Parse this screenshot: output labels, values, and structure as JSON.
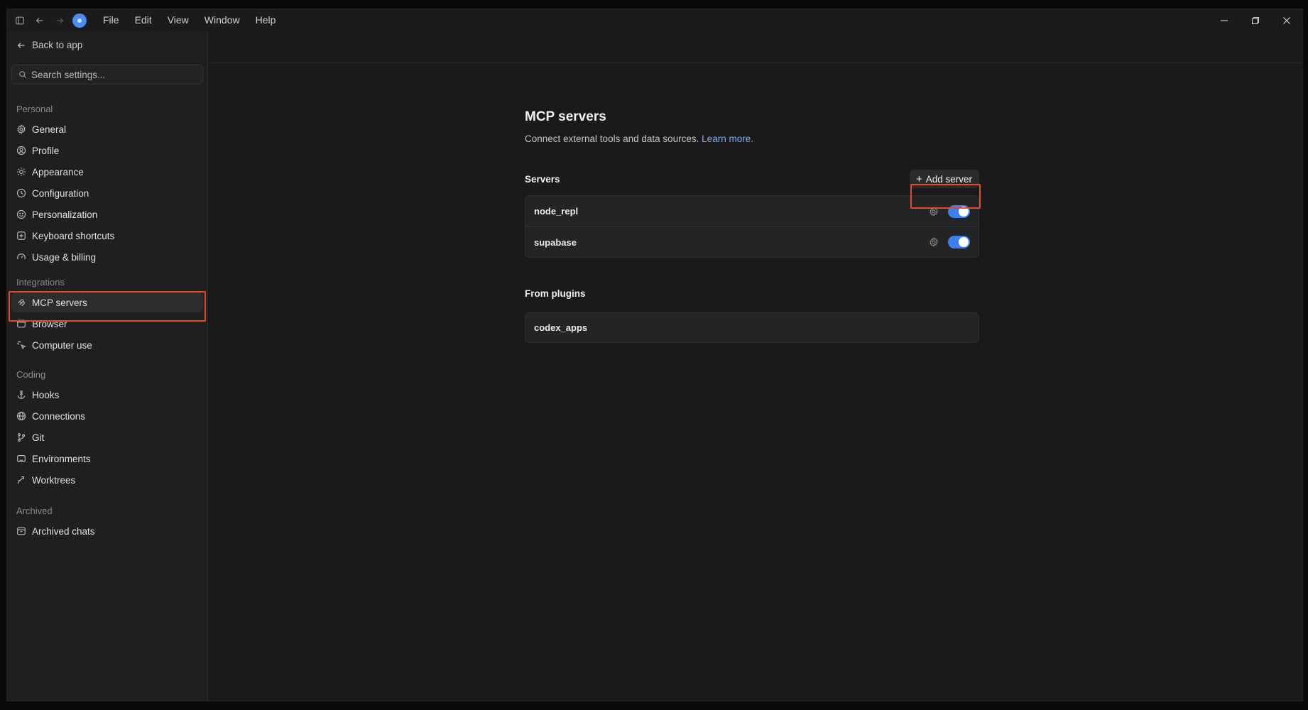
{
  "titlebar": {
    "menu": [
      "File",
      "Edit",
      "View",
      "Window",
      "Help"
    ]
  },
  "sidebar": {
    "back_label": "Back to app",
    "search_placeholder": "Search settings...",
    "sections": {
      "personal": "Personal",
      "integrations": "Integrations",
      "coding": "Coding",
      "archived": "Archived"
    },
    "personal_items": [
      "General",
      "Profile",
      "Appearance",
      "Configuration",
      "Personalization",
      "Keyboard shortcuts",
      "Usage & billing"
    ],
    "integration_items": [
      "MCP servers",
      "Browser",
      "Computer use"
    ],
    "coding_items": [
      "Hooks",
      "Connections",
      "Git",
      "Environments",
      "Worktrees"
    ],
    "archived_items": [
      "Archived chats"
    ],
    "active_item": "MCP servers"
  },
  "main": {
    "title": "MCP servers",
    "subtitle": "Connect external tools and data sources.",
    "learn_more": "Learn more.",
    "servers_label": "Servers",
    "add_server_label": "Add server",
    "servers": [
      {
        "name": "node_repl",
        "enabled": true
      },
      {
        "name": "supabase",
        "enabled": true
      }
    ],
    "plugins_label": "From plugins",
    "plugins": [
      "codex_apps"
    ]
  },
  "colors": {
    "accent": "#3d7ef0",
    "link": "#7aaef5",
    "highlight": "#e24a2c",
    "background": "#1a1a1a",
    "sidebar": "#1f1f1f"
  }
}
